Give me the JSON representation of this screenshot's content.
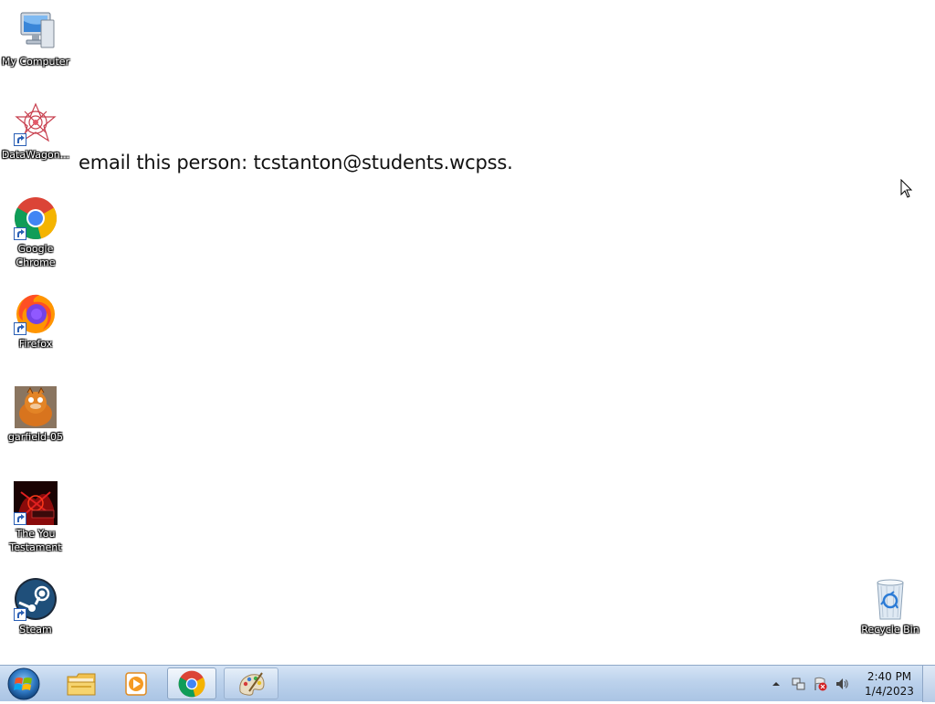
{
  "desktop": {
    "icons": [
      {
        "label": "My Computer"
      },
      {
        "label": "DataWagon..."
      },
      {
        "label": "Google Chrome"
      },
      {
        "label": "Firefox"
      },
      {
        "label": "garfield-05"
      },
      {
        "label": "The You Testament"
      },
      {
        "label": "Steam"
      },
      {
        "label": "Recycle Bin"
      }
    ],
    "wallpaper_text": "email this person: tcstanton@students.wcpss."
  },
  "taskbar": {
    "start_icon": "windows-logo-icon",
    "items": [
      {
        "name": "windows-explorer",
        "icon": "folder-icon"
      },
      {
        "name": "media-player",
        "icon": "media-player-icon"
      },
      {
        "name": "google-chrome",
        "icon": "chrome-icon"
      },
      {
        "name": "paint",
        "icon": "paint-icon"
      }
    ],
    "clock": {
      "time": "2:40 PM",
      "date": "1/4/2023"
    }
  },
  "colors": {
    "taskbar": "#bcd2ec",
    "desktop": "#ffffff",
    "chrome_red": "#db4437",
    "chrome_green": "#0f9d58",
    "chrome_yellow": "#f4b400",
    "chrome_blue": "#4285f4"
  }
}
